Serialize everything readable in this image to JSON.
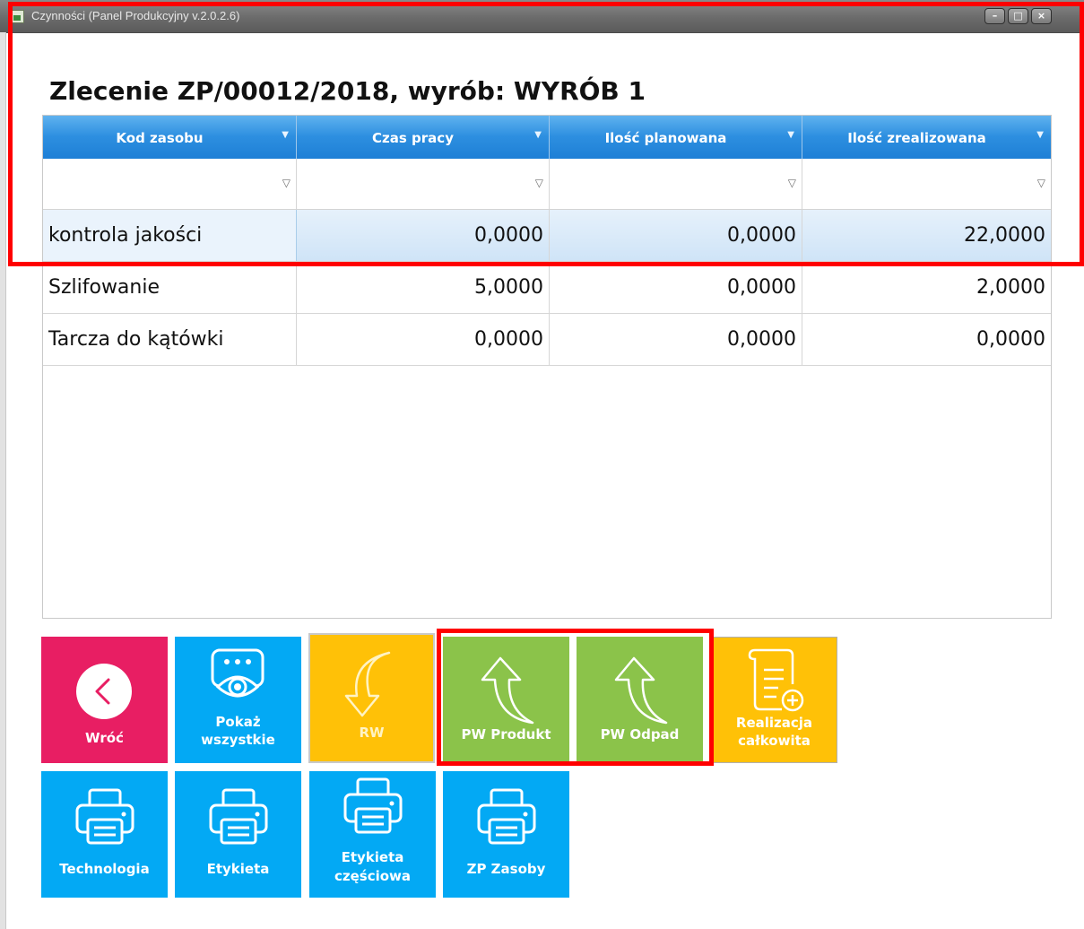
{
  "window": {
    "title": "Czynności (Panel Produkcyjny v.2.0.2.6)",
    "controls": {
      "minimize": "–",
      "maximize": "□",
      "close": "×"
    }
  },
  "heading": "Zlecenie ZP/00012/2018, wyrób: WYRÓB 1",
  "grid": {
    "columns": [
      "Kod zasobu",
      "Czas pracy",
      "Ilość planowana",
      "Ilość zrealizowana"
    ],
    "filter_icon": "filter-funnel-icon",
    "rows": [
      {
        "name": "kontrola jakości",
        "czas": "0,0000",
        "plan": "0,0000",
        "real": "22,0000",
        "selected": true
      },
      {
        "name": "Szlifowanie",
        "czas": "5,0000",
        "plan": "0,0000",
        "real": "2,0000",
        "selected": false
      },
      {
        "name": "Tarcza do kątówki",
        "czas": "0,0000",
        "plan": "0,0000",
        "real": "0,0000",
        "selected": false
      }
    ]
  },
  "tiles": {
    "back": {
      "label": "Wróć",
      "icon": "chevron-left-circle-icon",
      "color": "#e81e63"
    },
    "show_all": {
      "label_1": "Pokaż",
      "label_2": "wszystkie",
      "icon": "eye-screen-icon",
      "color": "#03a9f4"
    },
    "rw": {
      "label": "RW",
      "icon": "arrow-down-curved-icon",
      "color": "#ffc107",
      "disabled": true
    },
    "pw_product": {
      "label": "PW Produkt",
      "icon": "arrow-up-curved-icon",
      "color": "#8bc34a"
    },
    "pw_waste": {
      "label": "PW Odpad",
      "icon": "arrow-up-curved-icon",
      "color": "#8bc34a"
    },
    "full_realization": {
      "label_1": "Realizacja",
      "label_2": "całkowita",
      "icon": "document-plus-icon",
      "color": "#ffc107"
    },
    "technology": {
      "label": "Technologia",
      "icon": "printer-icon",
      "color": "#03a9f4"
    },
    "label": {
      "label": "Etykieta",
      "icon": "printer-icon",
      "color": "#03a9f4"
    },
    "partial_label": {
      "label_1": "Etykieta",
      "label_2": "częściowa",
      "icon": "printer-icon",
      "color": "#03a9f4"
    },
    "zp_resources": {
      "label": "ZP Zasoby",
      "icon": "printer-icon",
      "color": "#03a9f4"
    }
  },
  "highlight_color": "#ff0000"
}
